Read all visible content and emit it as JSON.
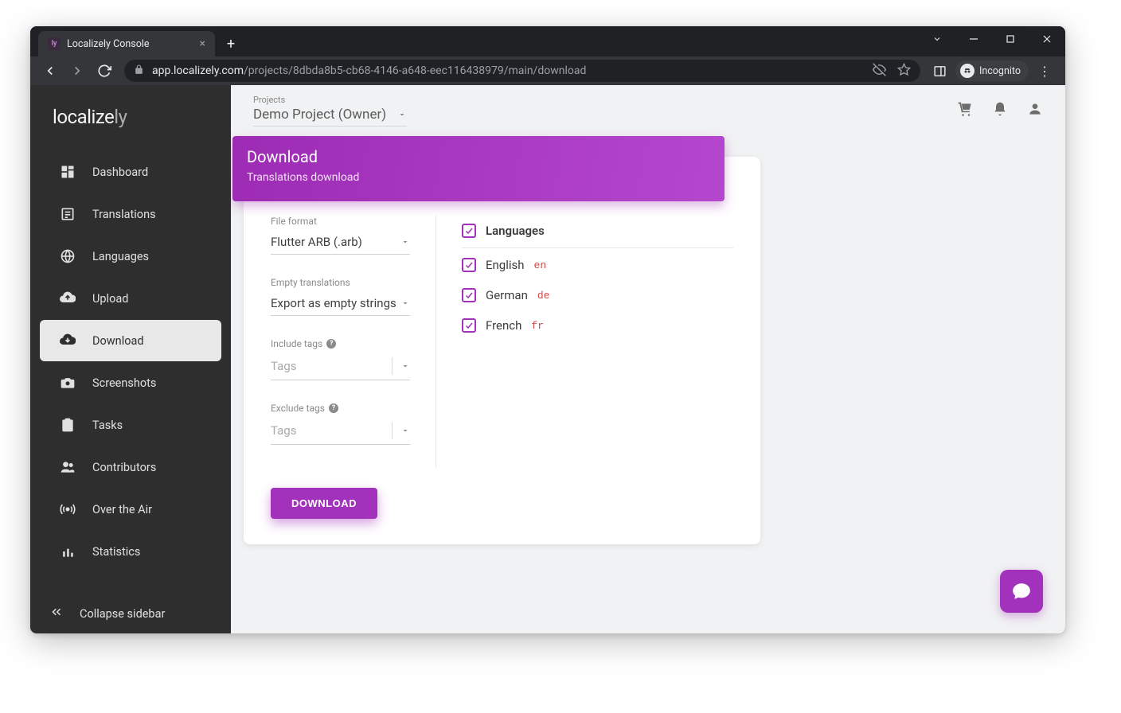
{
  "browser": {
    "tab_title": "Localizely Console",
    "url_domain": "app.localizely.com",
    "url_path": "/projects/8dbda8b5-cb68-4146-a648-eec116438979/main/download",
    "incognito_label": "Incognito"
  },
  "logo_prefix": "localize",
  "logo_suffix": "ly",
  "sidebar": {
    "items": [
      {
        "label": "Dashboard"
      },
      {
        "label": "Translations"
      },
      {
        "label": "Languages"
      },
      {
        "label": "Upload"
      },
      {
        "label": "Download"
      },
      {
        "label": "Screenshots"
      },
      {
        "label": "Tasks"
      },
      {
        "label": "Contributors"
      },
      {
        "label": "Over the Air"
      },
      {
        "label": "Statistics"
      }
    ],
    "collapse_label": "Collapse sidebar"
  },
  "topbar": {
    "projects_label": "Projects",
    "project_value": "Demo Project (Owner)"
  },
  "card": {
    "title": "Download",
    "subtitle": "Translations download",
    "file_format_label": "File format",
    "file_format_value": "Flutter ARB (.arb)",
    "empty_label": "Empty translations",
    "empty_value": "Export as empty strings",
    "include_tags_label": "Include tags",
    "exclude_tags_label": "Exclude tags",
    "tags_placeholder": "Tags",
    "languages_header": "Languages",
    "languages": [
      {
        "name": "English",
        "code": "en"
      },
      {
        "name": "German",
        "code": "de"
      },
      {
        "name": "French",
        "code": "fr"
      }
    ],
    "download_btn": "DOWNLOAD"
  }
}
